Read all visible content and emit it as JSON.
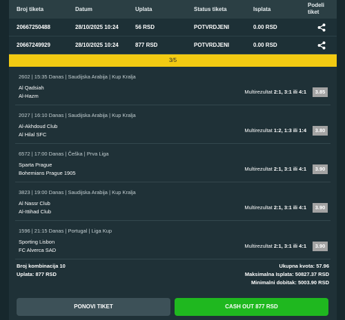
{
  "table": {
    "headers": {
      "ticket_number": "Broj tiketa",
      "date": "Datum",
      "payment": "Uplata",
      "status": "Status tiketa",
      "payout": "Isplata",
      "share_line1": "Podeli",
      "share_line2": "tiket"
    },
    "rows": [
      {
        "ticket_number": "20667250488",
        "date": "28/10/2025 10:24",
        "payment": "56 RSD",
        "status": "POTVRDJENI",
        "payout": "0.00 RSD",
        "share_icon": "share-icon"
      },
      {
        "ticket_number": "20667249929",
        "date": "28/10/2025 10:24",
        "payment": "877 RSD",
        "status": "POTVRDJENI",
        "payout": "0.00 RSD",
        "share_icon": "share-icon"
      }
    ]
  },
  "pager": {
    "label": "3/5"
  },
  "matches": [
    {
      "meta": "2602 | 15:35 Danas | Saudijska Arabija | Kup Kralja",
      "home": "Al Qadsiah",
      "away": "Al-Hazm",
      "pick_label": "Multirezultat",
      "pick_value": "2:1, 3:1 ili 4:1",
      "odd": "3.85"
    },
    {
      "meta": "2027 | 16:10 Danas | Saudijska Arabija | Kup Kralja",
      "home": "Al-Akhdoud Club",
      "away": "Al Hilal SFC",
      "pick_label": "Multirezultat",
      "pick_value": "1:2, 1:3 ili 1:4",
      "odd": "3.80"
    },
    {
      "meta": "6572 | 17:00 Danas | Češka | Prva Liga",
      "home": "Sparta Prague",
      "away": "Bohemians Prague 1905",
      "pick_label": "Multirezultat",
      "pick_value": "2:1, 3:1 ili 4:1",
      "odd": "3.90"
    },
    {
      "meta": "3823 | 19:00 Danas | Saudijska Arabija | Kup Kralja",
      "home": "Al Nassr Club",
      "away": "Al-Ittihad Club",
      "pick_label": "Multirezultat",
      "pick_value": "2:1, 3:1 ili 4:1",
      "odd": "3.90"
    },
    {
      "meta": "1596 | 21:15 Danas | Portugal | Liga Kup",
      "home": "Sporting Lisbon",
      "away": "FC Alverca SAD",
      "pick_label": "Multirezultat",
      "pick_value": "2:1, 3:1 ili 4:1",
      "odd": "3.90"
    }
  ],
  "summary": {
    "combinations": "Broj kombinacija 10",
    "payment": "Uplata: 877 RSD",
    "total_odd": "Ukupna kvota: 57.96",
    "max_payout": "Maksimalna Isplata: 50827.37 RSD",
    "min_win": "Minimalni dobitak: 5003.90 RSD"
  },
  "buttons": {
    "repeat": "PONOVI TIKET",
    "cashout": "CASH OUT 877 RSD"
  },
  "colors": {
    "background": "#17282d",
    "pager": "#f2ca12",
    "cashout": "#1fb81f",
    "odd_box": "#a3a3a3"
  }
}
